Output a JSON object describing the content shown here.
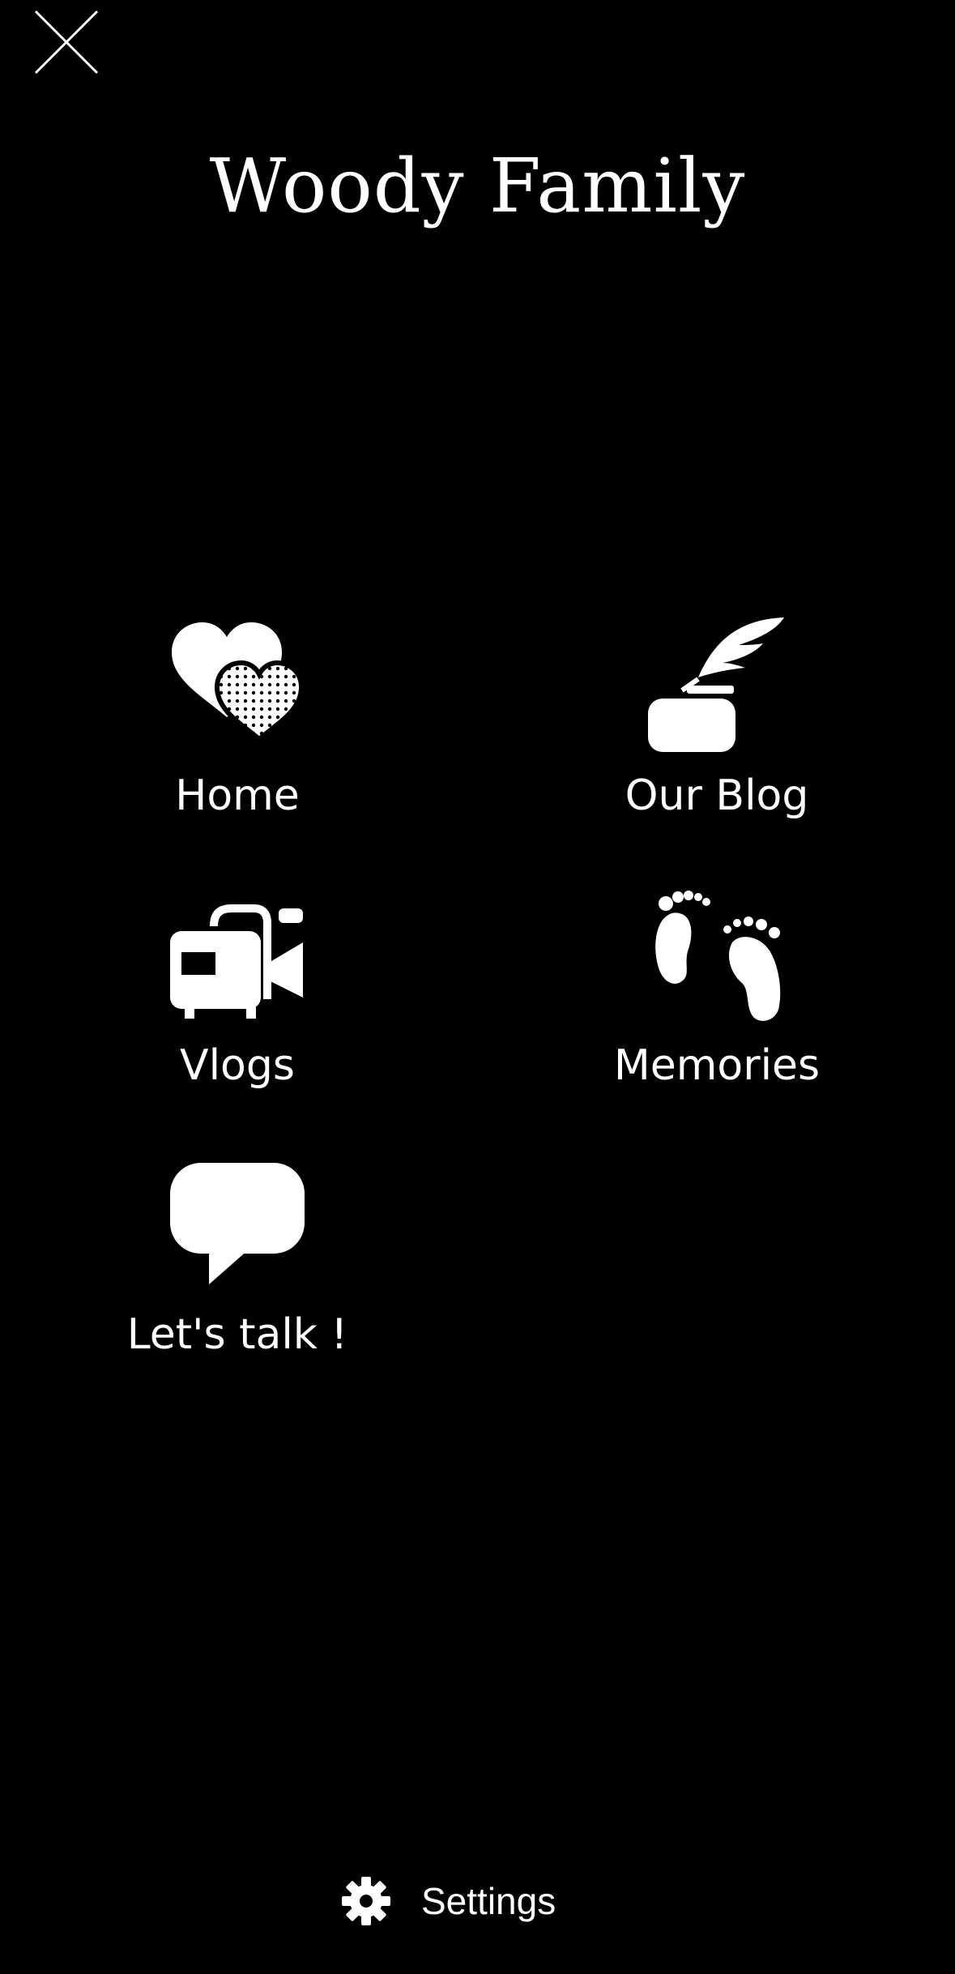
{
  "header": {
    "close_icon": "close-icon",
    "title": "Woody Family"
  },
  "menu": {
    "items": [
      {
        "label": "Home",
        "icon": "hearts-icon"
      },
      {
        "label": "Our Blog",
        "icon": "quill-inkwell-icon"
      },
      {
        "label": "Vlogs",
        "icon": "video-camera-icon"
      },
      {
        "label": "Memories",
        "icon": "baby-footprints-icon"
      },
      {
        "label": "Let's talk !",
        "icon": "speech-bubble-icon"
      }
    ]
  },
  "footer": {
    "settings_label": "Settings",
    "settings_icon": "gear-icon"
  },
  "colors": {
    "background": "#000000",
    "foreground": "#ffffff"
  }
}
